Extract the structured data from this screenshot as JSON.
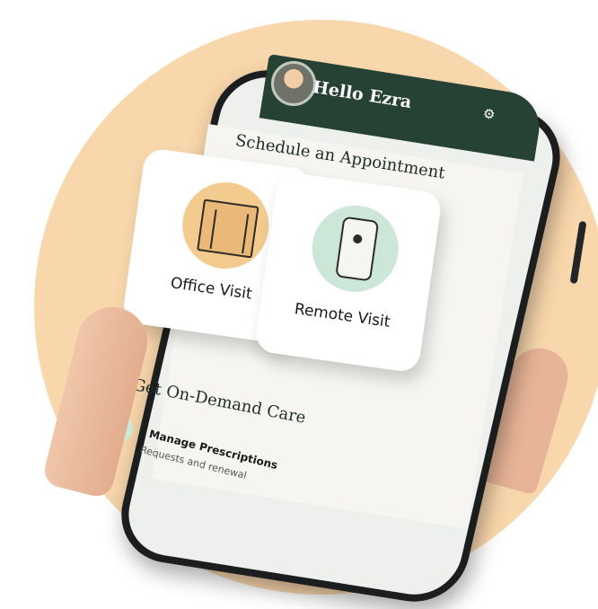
{
  "header": {
    "greeting": "Hello Ezra",
    "settings_icon": "gear-icon"
  },
  "schedule": {
    "title": "Schedule an Appointment",
    "cards": [
      {
        "label": "Office Visit",
        "icon": "office-building-icon",
        "icon_bg": "#f3cb8e"
      },
      {
        "label": "Remote Visit",
        "icon": "phone-video-icon",
        "icon_bg": "#cce6d7"
      }
    ]
  },
  "on_demand": {
    "title": "Get On-Demand Care",
    "items": [
      {
        "title": "Manage Prescriptions",
        "subtitle": "Requests and renewal",
        "icon": "pill-icon"
      }
    ]
  },
  "colors": {
    "header_bg": "#254235",
    "background_circle": "#f9d7ac",
    "accent_orange": "#f3cb8e",
    "accent_mint": "#cce6d7"
  }
}
